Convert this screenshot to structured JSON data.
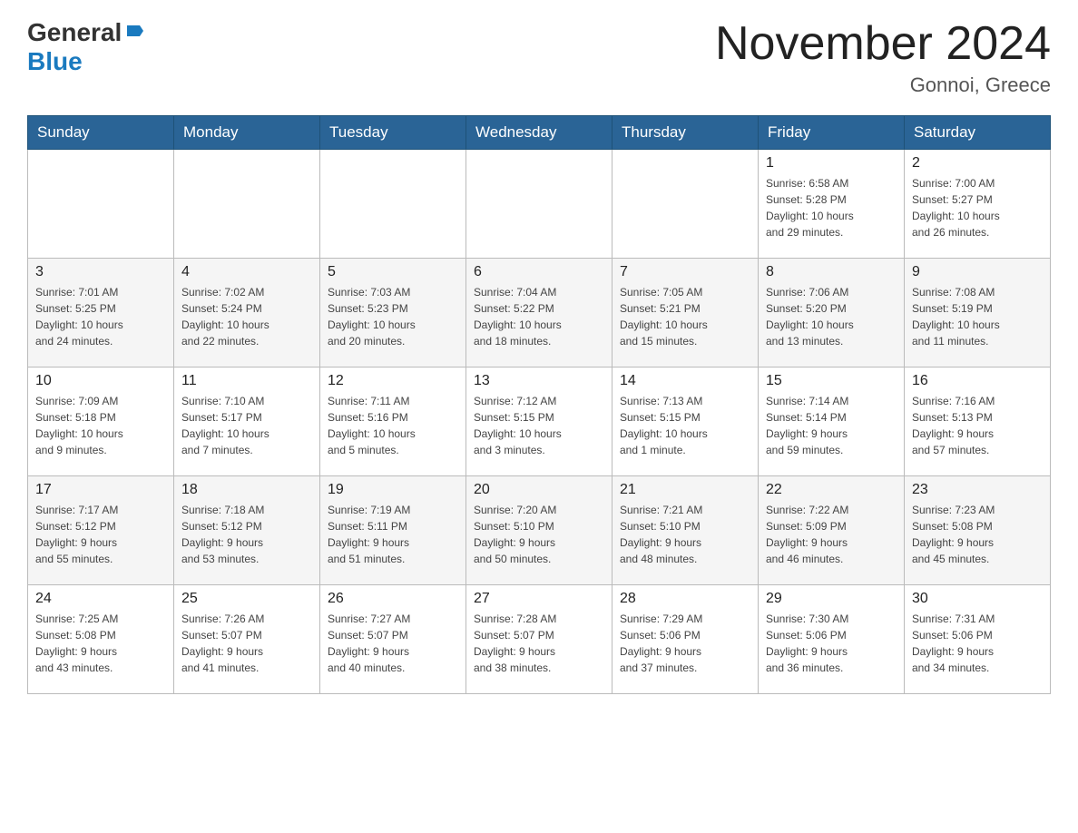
{
  "header": {
    "logo_line1": "General",
    "logo_line2": "Blue",
    "month_title": "November 2024",
    "location": "Gonnoi, Greece"
  },
  "weekdays": [
    "Sunday",
    "Monday",
    "Tuesday",
    "Wednesday",
    "Thursday",
    "Friday",
    "Saturday"
  ],
  "weeks": [
    [
      {
        "day": "",
        "info": ""
      },
      {
        "day": "",
        "info": ""
      },
      {
        "day": "",
        "info": ""
      },
      {
        "day": "",
        "info": ""
      },
      {
        "day": "",
        "info": ""
      },
      {
        "day": "1",
        "info": "Sunrise: 6:58 AM\nSunset: 5:28 PM\nDaylight: 10 hours\nand 29 minutes."
      },
      {
        "day": "2",
        "info": "Sunrise: 7:00 AM\nSunset: 5:27 PM\nDaylight: 10 hours\nand 26 minutes."
      }
    ],
    [
      {
        "day": "3",
        "info": "Sunrise: 7:01 AM\nSunset: 5:25 PM\nDaylight: 10 hours\nand 24 minutes."
      },
      {
        "day": "4",
        "info": "Sunrise: 7:02 AM\nSunset: 5:24 PM\nDaylight: 10 hours\nand 22 minutes."
      },
      {
        "day": "5",
        "info": "Sunrise: 7:03 AM\nSunset: 5:23 PM\nDaylight: 10 hours\nand 20 minutes."
      },
      {
        "day": "6",
        "info": "Sunrise: 7:04 AM\nSunset: 5:22 PM\nDaylight: 10 hours\nand 18 minutes."
      },
      {
        "day": "7",
        "info": "Sunrise: 7:05 AM\nSunset: 5:21 PM\nDaylight: 10 hours\nand 15 minutes."
      },
      {
        "day": "8",
        "info": "Sunrise: 7:06 AM\nSunset: 5:20 PM\nDaylight: 10 hours\nand 13 minutes."
      },
      {
        "day": "9",
        "info": "Sunrise: 7:08 AM\nSunset: 5:19 PM\nDaylight: 10 hours\nand 11 minutes."
      }
    ],
    [
      {
        "day": "10",
        "info": "Sunrise: 7:09 AM\nSunset: 5:18 PM\nDaylight: 10 hours\nand 9 minutes."
      },
      {
        "day": "11",
        "info": "Sunrise: 7:10 AM\nSunset: 5:17 PM\nDaylight: 10 hours\nand 7 minutes."
      },
      {
        "day": "12",
        "info": "Sunrise: 7:11 AM\nSunset: 5:16 PM\nDaylight: 10 hours\nand 5 minutes."
      },
      {
        "day": "13",
        "info": "Sunrise: 7:12 AM\nSunset: 5:15 PM\nDaylight: 10 hours\nand 3 minutes."
      },
      {
        "day": "14",
        "info": "Sunrise: 7:13 AM\nSunset: 5:15 PM\nDaylight: 10 hours\nand 1 minute."
      },
      {
        "day": "15",
        "info": "Sunrise: 7:14 AM\nSunset: 5:14 PM\nDaylight: 9 hours\nand 59 minutes."
      },
      {
        "day": "16",
        "info": "Sunrise: 7:16 AM\nSunset: 5:13 PM\nDaylight: 9 hours\nand 57 minutes."
      }
    ],
    [
      {
        "day": "17",
        "info": "Sunrise: 7:17 AM\nSunset: 5:12 PM\nDaylight: 9 hours\nand 55 minutes."
      },
      {
        "day": "18",
        "info": "Sunrise: 7:18 AM\nSunset: 5:12 PM\nDaylight: 9 hours\nand 53 minutes."
      },
      {
        "day": "19",
        "info": "Sunrise: 7:19 AM\nSunset: 5:11 PM\nDaylight: 9 hours\nand 51 minutes."
      },
      {
        "day": "20",
        "info": "Sunrise: 7:20 AM\nSunset: 5:10 PM\nDaylight: 9 hours\nand 50 minutes."
      },
      {
        "day": "21",
        "info": "Sunrise: 7:21 AM\nSunset: 5:10 PM\nDaylight: 9 hours\nand 48 minutes."
      },
      {
        "day": "22",
        "info": "Sunrise: 7:22 AM\nSunset: 5:09 PM\nDaylight: 9 hours\nand 46 minutes."
      },
      {
        "day": "23",
        "info": "Sunrise: 7:23 AM\nSunset: 5:08 PM\nDaylight: 9 hours\nand 45 minutes."
      }
    ],
    [
      {
        "day": "24",
        "info": "Sunrise: 7:25 AM\nSunset: 5:08 PM\nDaylight: 9 hours\nand 43 minutes."
      },
      {
        "day": "25",
        "info": "Sunrise: 7:26 AM\nSunset: 5:07 PM\nDaylight: 9 hours\nand 41 minutes."
      },
      {
        "day": "26",
        "info": "Sunrise: 7:27 AM\nSunset: 5:07 PM\nDaylight: 9 hours\nand 40 minutes."
      },
      {
        "day": "27",
        "info": "Sunrise: 7:28 AM\nSunset: 5:07 PM\nDaylight: 9 hours\nand 38 minutes."
      },
      {
        "day": "28",
        "info": "Sunrise: 7:29 AM\nSunset: 5:06 PM\nDaylight: 9 hours\nand 37 minutes."
      },
      {
        "day": "29",
        "info": "Sunrise: 7:30 AM\nSunset: 5:06 PM\nDaylight: 9 hours\nand 36 minutes."
      },
      {
        "day": "30",
        "info": "Sunrise: 7:31 AM\nSunset: 5:06 PM\nDaylight: 9 hours\nand 34 minutes."
      }
    ]
  ]
}
